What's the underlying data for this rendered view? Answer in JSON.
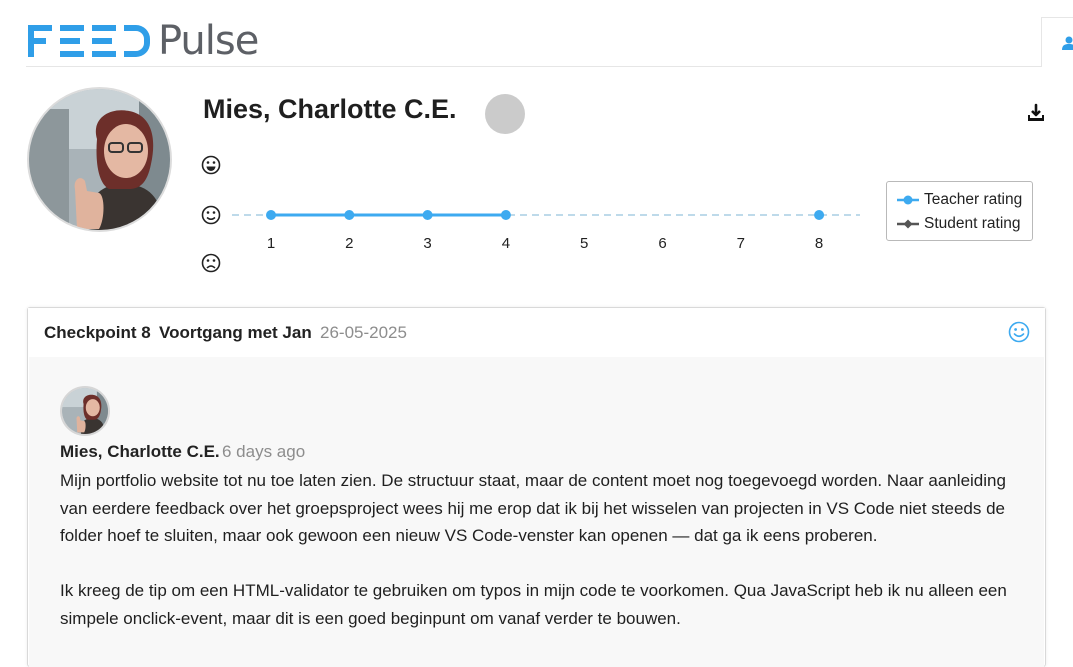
{
  "header": {
    "logo_feed": "FEED",
    "logo_pulse": "Pulse",
    "brand_color": "#2f9ee8",
    "user_icon": "user-icon"
  },
  "profile": {
    "name": "Mies, Charlotte C.E.",
    "status_color": "#cbcbcb",
    "download_icon": "download-icon"
  },
  "chart_data": {
    "type": "line",
    "x": [
      1,
      2,
      3,
      4,
      5,
      6,
      7,
      8
    ],
    "tick_labels": [
      "1",
      "2",
      "3",
      "4",
      "5",
      "6",
      "7",
      "8"
    ],
    "y_levels": [
      "sad",
      "neutral",
      "happy"
    ],
    "series": [
      {
        "name": "Teacher rating",
        "color": "#3daaf0",
        "points": [
          [
            1,
            "neutral"
          ],
          [
            2,
            "neutral"
          ],
          [
            3,
            "neutral"
          ],
          [
            4,
            "neutral"
          ],
          [
            8,
            "neutral"
          ]
        ]
      },
      {
        "name": "Student rating",
        "color": "#555555",
        "points": []
      }
    ],
    "legend_position": "right"
  },
  "legend": {
    "teacher": "Teacher rating",
    "student": "Student rating"
  },
  "checkpoint": {
    "label": "Checkpoint 8",
    "title": "Voortgang met Jan",
    "date": "26-05-2025",
    "rating_icon": "smiley-icon",
    "rating_color": "#3daaf0"
  },
  "comment": {
    "author": "Mies, Charlotte C.E.",
    "time": "6 days ago",
    "paragraphs": [
      "Mijn portfolio website tot nu toe laten zien. De structuur staat, maar de content moet nog toegevoegd worden. Naar aanleiding van eerdere feedback over het groepsproject wees hij me erop dat ik bij het wisselen van projecten in VS Code niet steeds de folder hoef te sluiten, maar ook gewoon een nieuw VS Code-venster kan openen — dat ga ik eens proberen.",
      "Ik kreeg de tip om een HTML-validator te gebruiken om typos in mijn code te voorkomen. Qua JavaScript heb ik nu alleen een simpele onclick-event, maar dit is een goed beginpunt om vanaf verder te bouwen."
    ]
  }
}
